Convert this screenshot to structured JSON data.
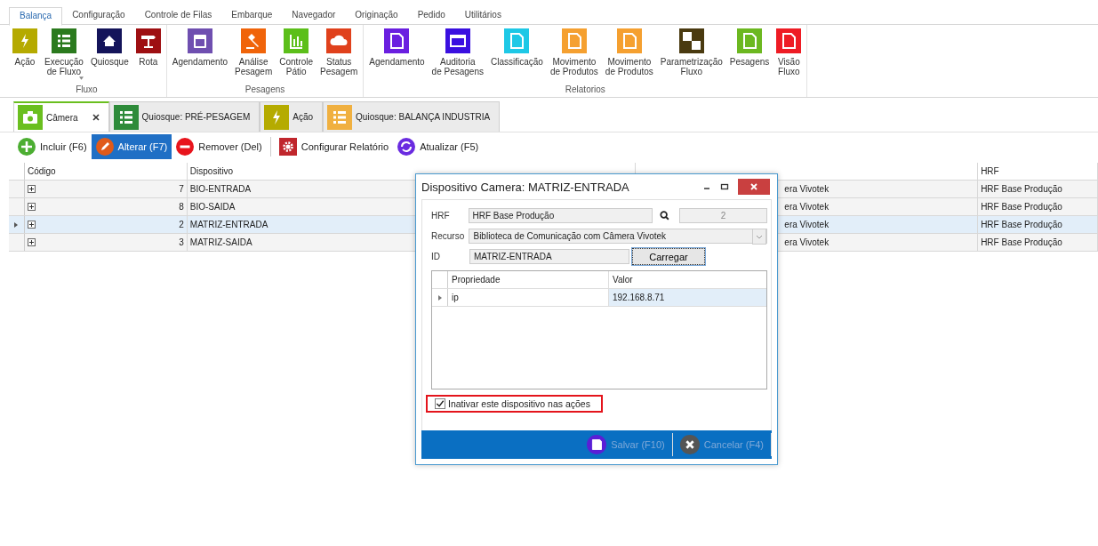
{
  "ribbon": {
    "tabs": [
      {
        "label": "Balança",
        "selected": true
      },
      {
        "label": "Configuração",
        "selected": false
      },
      {
        "label": "Controle de Filas",
        "selected": false
      },
      {
        "label": "Embarque",
        "selected": false
      },
      {
        "label": "Navegador",
        "selected": false
      },
      {
        "label": "Originação",
        "selected": false
      },
      {
        "label": "Pedido",
        "selected": false
      },
      {
        "label": "Utilitários",
        "selected": false
      }
    ],
    "groups": [
      {
        "label": "Fluxo",
        "buttons": [
          {
            "label": "Ação",
            "kind": "bolt",
            "color": "#b5aa00"
          },
          {
            "label": "Execução\nde Fluxo",
            "kind": "list",
            "color": "#2b7a1e",
            "dropdown": true
          },
          {
            "label": "Quiosque",
            "kind": "house",
            "color": "#14145a"
          },
          {
            "label": "Rota",
            "kind": "sign",
            "color": "#9e0f12"
          }
        ]
      },
      {
        "label": "Pesagens",
        "buttons": [
          {
            "label": "Agendamento",
            "kind": "calendar",
            "color": "#6f4fb0"
          },
          {
            "label": "Análise\nPesagem",
            "kind": "gavel",
            "color": "#f0640a"
          },
          {
            "label": "Controle\nPátio",
            "kind": "chart",
            "color": "#5cbf1a"
          },
          {
            "label": "Status\nPesagem",
            "kind": "cloud",
            "color": "#e0411c"
          }
        ]
      },
      {
        "label": "Relatorios",
        "buttons": [
          {
            "label": "Agendamento",
            "kind": "doc",
            "color": "#6a1fe0"
          },
          {
            "label": "Auditoria\nde Pesagens",
            "kind": "window",
            "color": "#3a10e0"
          },
          {
            "label": "Classificação",
            "kind": "doc",
            "color": "#1ec8e6"
          },
          {
            "label": "Movimento\nde Produtos",
            "kind": "doc",
            "color": "#f5a030"
          },
          {
            "label": "Movimento\nde Produtos",
            "kind": "doc",
            "color": "#f5a030"
          },
          {
            "label": "Parametrização\nFluxo",
            "kind": "checker",
            "color": "#4a3a10"
          },
          {
            "label": "Pesagens",
            "kind": "doc",
            "color": "#6cb820"
          },
          {
            "label": "Visão\nFluxo",
            "kind": "doc",
            "color": "#ee1c24"
          }
        ]
      }
    ]
  },
  "doc_tabs": [
    {
      "label": "Câmera",
      "kind": "camera",
      "color": "#6abf1f",
      "selected": true,
      "closable": true
    },
    {
      "label": "Quiosque: PRÉ-PESAGEM",
      "kind": "list",
      "color": "#2e8b3a",
      "selected": false,
      "closable": false
    },
    {
      "label": "Ação",
      "kind": "bolt",
      "color": "#b5ab00",
      "selected": false,
      "closable": false
    },
    {
      "label": "Quiosque: BALANÇA INDUSTRIA",
      "kind": "list",
      "color": "#f0b040",
      "selected": false,
      "closable": false
    }
  ],
  "toolbar": [
    {
      "label": "Incluir (F6)",
      "kind": "plus",
      "color": "#4cae32",
      "selected": false
    },
    {
      "label": "Alterar (F7)",
      "kind": "pencil",
      "color": "#e05a1a",
      "selected": true
    },
    {
      "label": "Remover (Del)",
      "kind": "minus",
      "color": "#e8141c",
      "selected": false
    },
    {
      "label": "Configurar Relatório",
      "kind": "gear",
      "color": "#c0262c",
      "selected": false
    },
    {
      "label": "Atualizar (F5)",
      "kind": "refresh",
      "color": "#6a2be0",
      "selected": false
    }
  ],
  "grid": {
    "columns": [
      "Código",
      "Dispositivo",
      "HRF"
    ],
    "rows": [
      {
        "code": "7",
        "device": "BIO-ENTRADA",
        "column_3": "era Vivotek",
        "hrf": "HRF Base Produção",
        "selected": false
      },
      {
        "code": "8",
        "device": "BIO-SAIDA",
        "column_3": "era Vivotek",
        "hrf": "HRF Base Produção",
        "selected": false
      },
      {
        "code": "2",
        "device": "MATRIZ-ENTRADA",
        "column_3": "era Vivotek",
        "hrf": "HRF Base Produção",
        "selected": true
      },
      {
        "code": "3",
        "device": "MATRIZ-SAIDA",
        "column_3": "era Vivotek",
        "hrf": "HRF Base Produção",
        "selected": false
      }
    ]
  },
  "dialog": {
    "title": "Dispositivo Camera: MATRIZ-ENTRADA",
    "hrf": {
      "label": "HRF",
      "value": "HRF Base Produção",
      "number": "2"
    },
    "recurso": {
      "label": "Recurso",
      "value": "Biblioteca de Comunicação com Câmera Vivotek"
    },
    "id": {
      "label": "ID",
      "value": "MATRIZ-ENTRADA",
      "button": "Carregar"
    },
    "properties": {
      "columns": [
        "Propriedade",
        "Valor"
      ],
      "rows": [
        {
          "name": "ip",
          "value": "192.168.8.71"
        }
      ]
    },
    "inactive": {
      "label": "Inativar este dispositivo nas ações",
      "checked": true
    },
    "buttons": [
      {
        "label": "Salvar (F10)",
        "kind": "save",
        "color": "#5a1fd6"
      },
      {
        "label": "Cancelar (F4)",
        "kind": "cancel",
        "color": "#555555"
      }
    ]
  }
}
